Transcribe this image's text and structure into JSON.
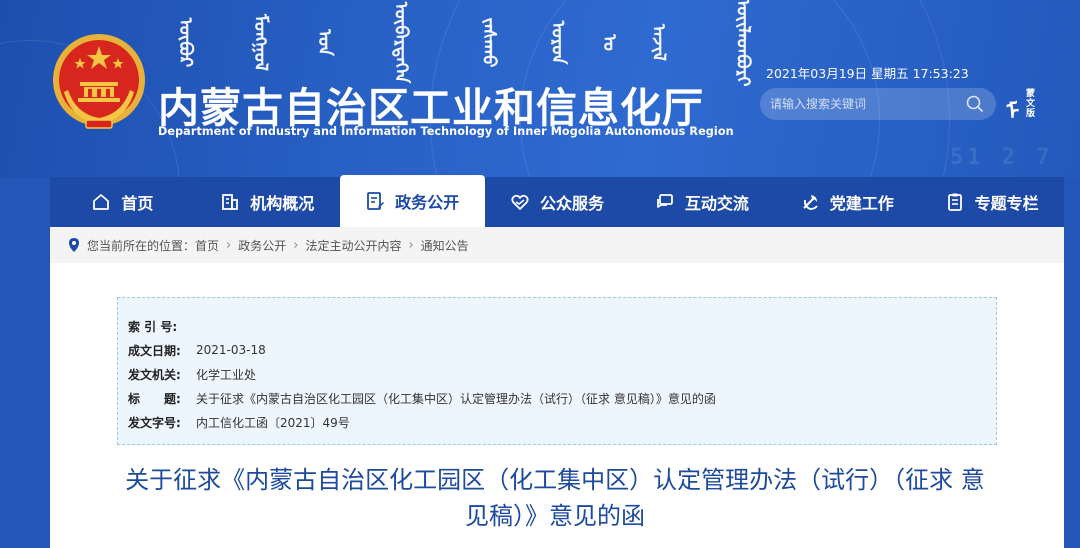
{
  "header": {
    "mongolian_script": [
      "ᠥᠪᠦᠷ",
      "ᠮᠣᠩᠭᠣᠯ",
      "ᠤᠨ",
      "ᠥᠪᠡᠷᠲᠡᠭᠡᠨ",
      "ᠵᠠᠰᠠᠬᠤ",
      "ᠣᠷᠤᠨ",
      "ᠤ",
      "ᠠᠵᠢᠯ",
      "ᠦᠢᠯᠡᠳᠪᠦᠷᠢ"
    ],
    "title": "内蒙古自治区工业和信息化厅",
    "subtitle": "Department of Industry and Information Technology of Inner Mogolia Autonomous Region",
    "datetime": "2021年03月19日 星期五 17:53:23",
    "search_placeholder": "请输入搜索关键词",
    "mongolian_version_glyph": "ᠮ",
    "mongolian_version_label": "蒙文版",
    "deco_digits": "51 2 7"
  },
  "nav": {
    "items": [
      {
        "label": "首页",
        "icon": "home-icon"
      },
      {
        "label": "机构概况",
        "icon": "building-icon"
      },
      {
        "label": "政务公开",
        "icon": "document-edit-icon",
        "active": true
      },
      {
        "label": "公众服务",
        "icon": "heart-hands-icon"
      },
      {
        "label": "互动交流",
        "icon": "chat-icon"
      },
      {
        "label": "党建工作",
        "icon": "party-emblem-icon"
      },
      {
        "label": "专题专栏",
        "icon": "clipboard-icon"
      }
    ]
  },
  "breadcrumb": {
    "prefix": "您当前所在的位置：",
    "items": [
      "首页",
      "政务公开",
      "法定主动公开内容",
      "通知公告"
    ]
  },
  "info": {
    "index_label": "索 引 号:",
    "index_value": "",
    "date_label": "成文日期:",
    "date_value": "2021-03-18",
    "issuer_label": "发文机关:",
    "issuer_value": "化学工业处",
    "title_label": "标　　题:",
    "title_value": "关于征求《内蒙古自治区化工园区（化工集中区）认定管理办法（试行）（征求 意见稿）》意见的函",
    "docno_label": "发文字号:",
    "docno_value": "内工信化工函〔2021〕49号"
  },
  "document": {
    "title_line1": "关于征求《内蒙古自治区化工园区（化工集中区）认定管理办法（试行）（征求 意",
    "title_line2": "见稿）》意见的函"
  },
  "colors": {
    "header_blue": "#2a63c8",
    "nav_blue": "#1c4aa6",
    "title_blue": "#1c4a9c",
    "emblem_red": "#d7261e",
    "emblem_gold": "#f6c544"
  }
}
